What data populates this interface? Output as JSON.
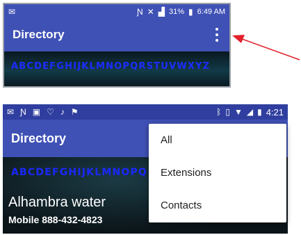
{
  "top_screen": {
    "status_right": "31%",
    "time": "6:49 AM",
    "app_title": "Directory",
    "alphabet": "ABCDEFGHIJKLMNOPQRSTUVWXYZ"
  },
  "annotation": {
    "arrow_color": "#e3202c"
  },
  "bottom_screen": {
    "status_icons": [
      "mail-icon",
      "nfc-icon",
      "google-plus-icon",
      "heart-icon",
      "bell-icon",
      "flag-icon"
    ],
    "time": "4:21",
    "app_title": "Directory",
    "alphabet": "ABCDEFGHIJKLMNOPQ",
    "contact": {
      "name": "Alhambra water",
      "phone": "Mobile  888-432-4823"
    },
    "menu": [
      "All",
      "Extensions",
      "Contacts"
    ]
  },
  "colors": {
    "app_bar": "#3f51b5",
    "status_bar": "#303f9f",
    "alphabet": "#1d2cff"
  }
}
